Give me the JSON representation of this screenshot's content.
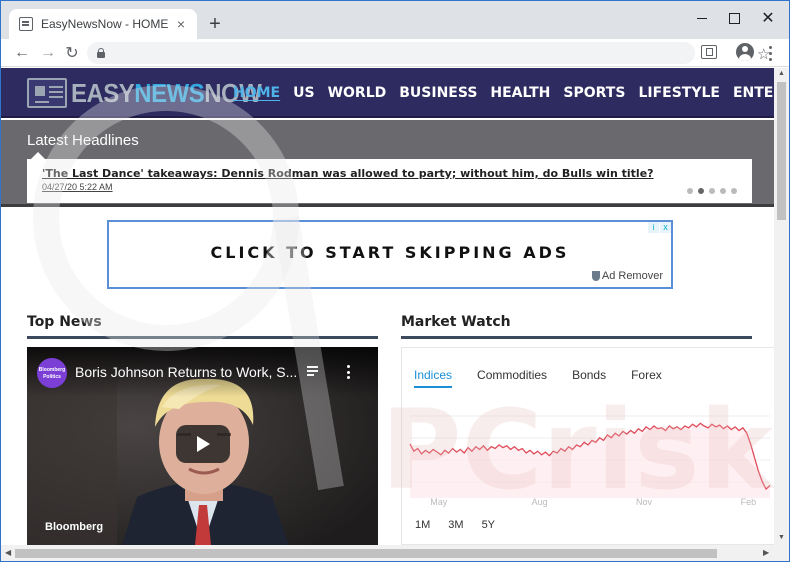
{
  "browser": {
    "tab_title": "EasyNewsNow - HOME",
    "tab_close": "×",
    "new_tab": "+",
    "window_close": "✕",
    "back": "←",
    "forward": "→",
    "reload": "↻",
    "bookmark_star": "☆",
    "address_value": ""
  },
  "site": {
    "logo": {
      "part1": "EASY",
      "part2": "NEWS",
      "part3": "NOW"
    },
    "nav": [
      "HOME",
      "US",
      "WORLD",
      "BUSINESS",
      "HEALTH",
      "SPORTS",
      "LIFESTYLE",
      "ENTERTAINMENT"
    ],
    "active_nav": "HOME",
    "colors": {
      "header": "#2d2b5f",
      "accent": "#33a9e0",
      "band": "#6a6a6e"
    }
  },
  "headlines": {
    "title": "Latest Headlines",
    "headline": "'The Last Dance' takeaways: Dennis Rodman was allowed to party; without him, do Bulls win title?",
    "date": "04/27/20 5:22 AM",
    "slide_count": 5,
    "active_slide": 2
  },
  "ad": {
    "text": "CLICK TO START SKIPPING ADS",
    "choices_i": "i",
    "choices_x": "x",
    "remover": "Ad Remover"
  },
  "top_news": {
    "title": "Top News",
    "video": {
      "channel_avatar_text": "Bloomberg Politics",
      "title": "Boris Johnson Returns to Work, S...",
      "brand": "Bloomberg"
    }
  },
  "market_watch": {
    "title": "Market Watch",
    "tabs": [
      "Indices",
      "Commodities",
      "Bonds",
      "Forex"
    ],
    "active_tab": "Indices",
    "ranges": [
      "1M",
      "3M",
      "5Y"
    ]
  },
  "chart_data": {
    "type": "line",
    "x_tick_labels": [
      "May",
      "Aug",
      "Nov",
      "Feb"
    ],
    "y_tick_labels": [
      "",
      "",
      "",
      ""
    ],
    "series": [
      {
        "color": "#e04a5a",
        "values": [
          60,
          52,
          55,
          49,
          53,
          50,
          54,
          51,
          48,
          53,
          50,
          55,
          51,
          54,
          50,
          56,
          52,
          57,
          54,
          58,
          53,
          57,
          55,
          59,
          56,
          58,
          54,
          57,
          53,
          55,
          50,
          53,
          49,
          52,
          48,
          51,
          47,
          52,
          50,
          55,
          52,
          57,
          54,
          59,
          57,
          62,
          59,
          64,
          62,
          67,
          64,
          70,
          67,
          72,
          69,
          74,
          71,
          75,
          72,
          77,
          74,
          79,
          76,
          80,
          77,
          78,
          75,
          80,
          77,
          79,
          76,
          80,
          78,
          82,
          79,
          83,
          80,
          78,
          82,
          79,
          81,
          77,
          80,
          76,
          79,
          75,
          78,
          72,
          60,
          45,
          30,
          18,
          10,
          14
        ]
      }
    ],
    "ylim": [
      0,
      100
    ],
    "grid": true,
    "fill": "#fde9ec"
  },
  "watermark": "PCrisk.com"
}
